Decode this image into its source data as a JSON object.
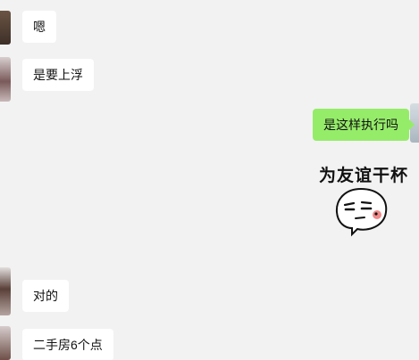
{
  "messages": [
    {
      "direction": "incoming",
      "text": "嗯"
    },
    {
      "direction": "incoming",
      "text": "是要上浮"
    },
    {
      "direction": "outgoing",
      "text": "是这样执行吗"
    },
    {
      "direction": "outgoing",
      "sticker": {
        "caption": "为友谊干杯",
        "icon": "cartoon-face-sticker-icon"
      }
    },
    {
      "direction": "incoming",
      "text": "对的"
    },
    {
      "direction": "incoming",
      "text": "二手房6个点"
    }
  ],
  "colors": {
    "background": "#f2f2f2",
    "incoming_bubble": "#ffffff",
    "outgoing_bubble": "#95ec69",
    "avatar_left": "#5a4a3c",
    "avatar_right": "#c9d4da"
  }
}
